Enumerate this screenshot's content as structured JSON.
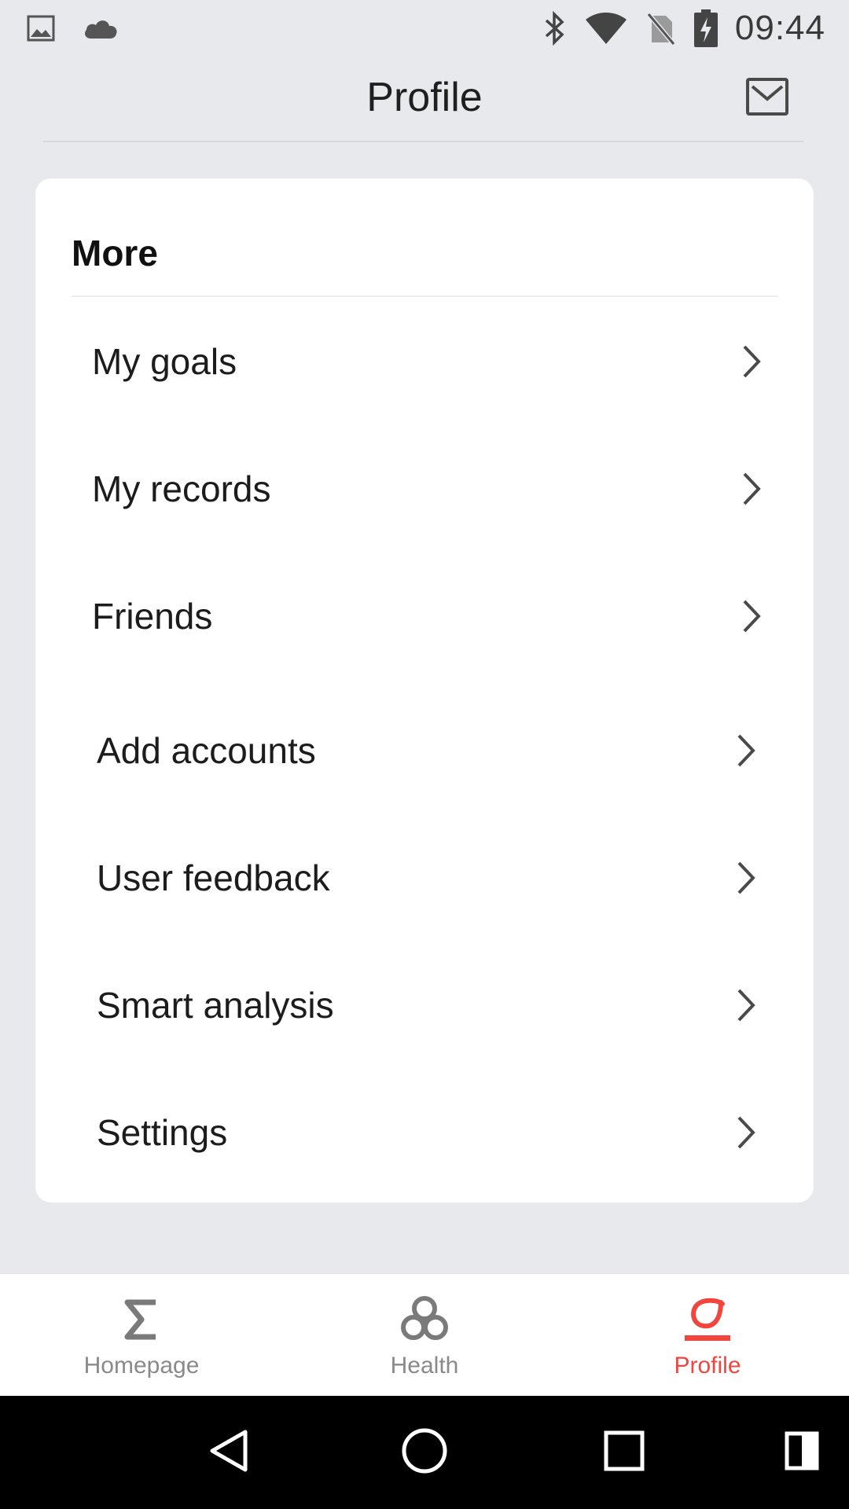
{
  "status_bar": {
    "time": "09:44",
    "left_icons": [
      "image-icon",
      "cloud-icon"
    ],
    "right_icons": [
      "bluetooth-icon",
      "wifi-icon",
      "no-sim-icon",
      "battery-charging-icon"
    ]
  },
  "header": {
    "title": "Profile",
    "mail_icon": "mail-icon"
  },
  "card": {
    "title": "More",
    "items": [
      {
        "label": "My goals"
      },
      {
        "label": "My records"
      },
      {
        "label": "Friends"
      },
      {
        "label": "Add accounts"
      },
      {
        "label": "User feedback"
      },
      {
        "label": "Smart analysis"
      },
      {
        "label": "Settings"
      }
    ]
  },
  "bottom_nav": {
    "tabs": [
      {
        "label": "Homepage",
        "icon": "sigma-icon",
        "active": false
      },
      {
        "label": "Health",
        "icon": "health-icon",
        "active": false
      },
      {
        "label": "Profile",
        "icon": "profile-icon",
        "active": true
      }
    ]
  },
  "system_nav": {
    "buttons": [
      "back-icon",
      "home-icon",
      "recents-icon",
      "split-icon"
    ]
  },
  "colors": {
    "background": "#e8e9ed",
    "card": "#ffffff",
    "accent": "#f2453d",
    "inactive": "#8a8a8a"
  }
}
